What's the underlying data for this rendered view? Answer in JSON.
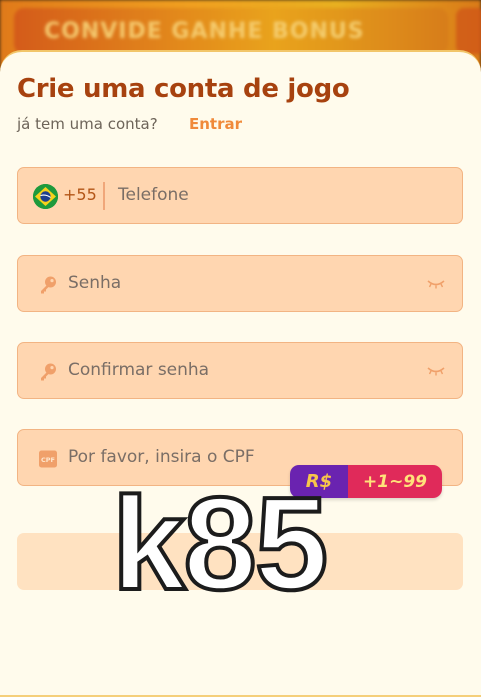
{
  "background": {
    "banner_text": "CONVIDE GANHE BONUS"
  },
  "form": {
    "title": "Crie uma conta de jogo",
    "subtitle": "já tem uma conta?",
    "login_link": "Entrar",
    "phone": {
      "country_code": "+55",
      "placeholder": "Telefone",
      "flag_icon": "brazil-flag-icon"
    },
    "password": {
      "placeholder": "Senha",
      "icon": "key-icon",
      "toggle_icon": "eye-closed-icon"
    },
    "confirm_password": {
      "placeholder": "Confirmar senha",
      "icon": "key-icon",
      "toggle_icon": "eye-closed-icon"
    },
    "cpf": {
      "placeholder": "Por favor, insira o CPF",
      "icon": "cpf-card-icon",
      "icon_text": "CPF"
    },
    "submit_label": ""
  },
  "promo_badge": {
    "currency": "R$",
    "bonus": "+1~99"
  },
  "watermark": {
    "text": "k85"
  },
  "colors": {
    "title": "#a7420f",
    "accent": "#f08a3a",
    "field_bg": "#ffd6b0",
    "sheet_bg": "#fffbec"
  }
}
